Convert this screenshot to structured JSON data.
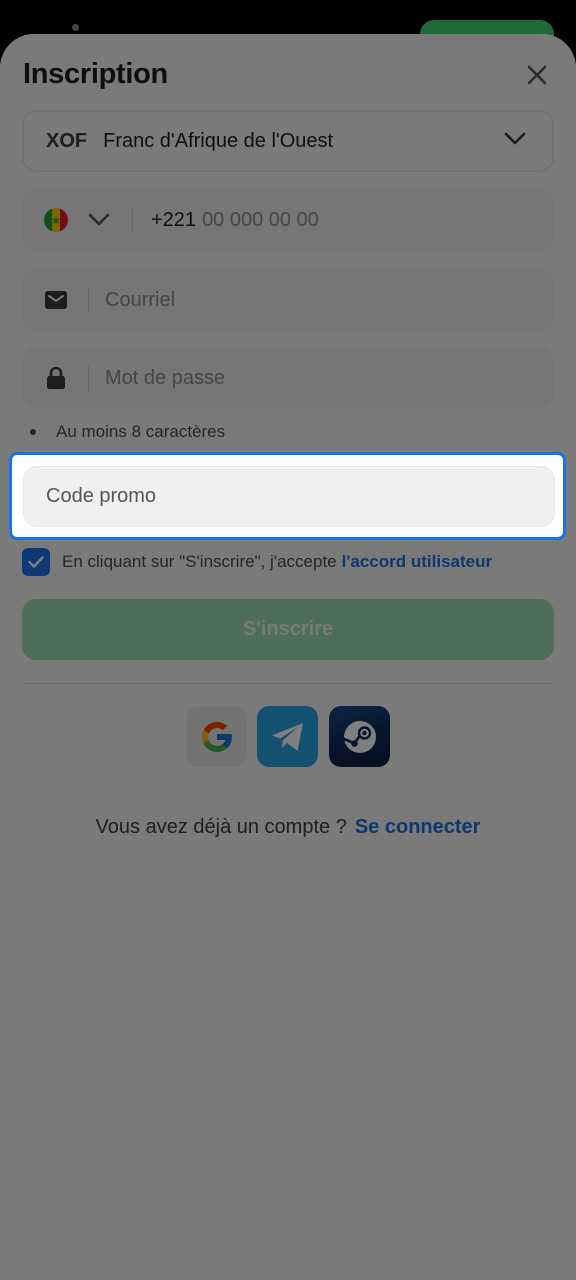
{
  "header": {
    "title": "Inscription"
  },
  "currency": {
    "code": "XOF",
    "name": "Franc d'Afrique de l'Ouest"
  },
  "phone": {
    "prefix": "+221",
    "placeholder": "00 000 00 00"
  },
  "email": {
    "placeholder": "Courriel"
  },
  "password": {
    "placeholder": "Mot de passe",
    "hint": "Au moins 8 caractères"
  },
  "promo": {
    "placeholder": "Code promo"
  },
  "agreement": {
    "text": "En cliquant sur \"S'inscrire\", j'accepte",
    "link": "l'accord utilisateur",
    "checked": true
  },
  "submit": {
    "label": "S'inscrire"
  },
  "login": {
    "text": "Vous avez déjà un compte ?",
    "link": "Se connecter"
  },
  "icons": {
    "close": "close-icon",
    "dropdown": "chevron-down-icon",
    "flag": "senegal-flag-icon",
    "email": "envelope-icon",
    "password": "lock-icon",
    "check": "check-icon",
    "google": "google-icon",
    "telegram": "telegram-icon",
    "steam": "steam-icon"
  },
  "colors": {
    "accent": "#1a74e8",
    "submit": "#9fddb0",
    "link": "#1a6fdc"
  }
}
